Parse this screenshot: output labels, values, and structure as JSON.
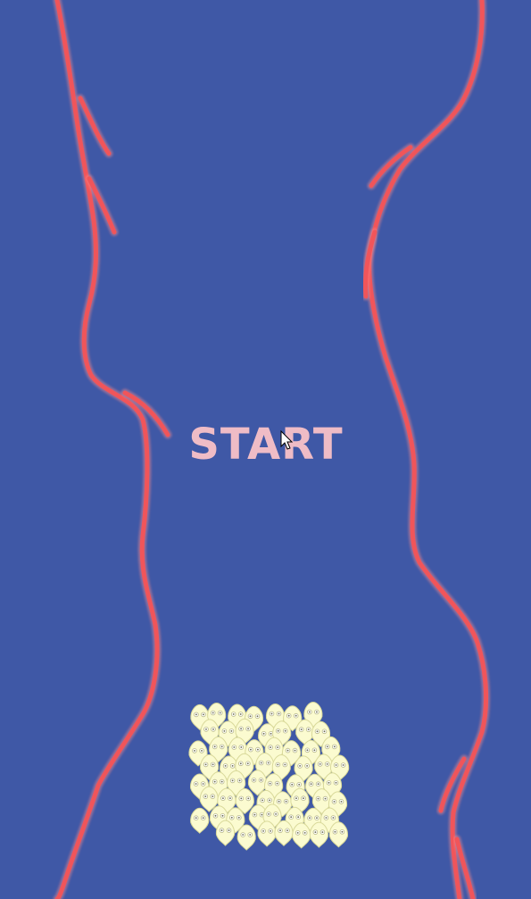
{
  "game": {
    "start_label": "START",
    "colors": {
      "background": "#3f58a6",
      "wall": "#f0555a",
      "wall_glow": "#ff8a8a",
      "start_text": "#efbcc6",
      "creature_fill": "#fbfbd0",
      "creature_outline": "#d9d99a"
    },
    "icons": {
      "creature": "spiky-creature-icon",
      "cursor": "mouse-pointer-icon"
    }
  }
}
